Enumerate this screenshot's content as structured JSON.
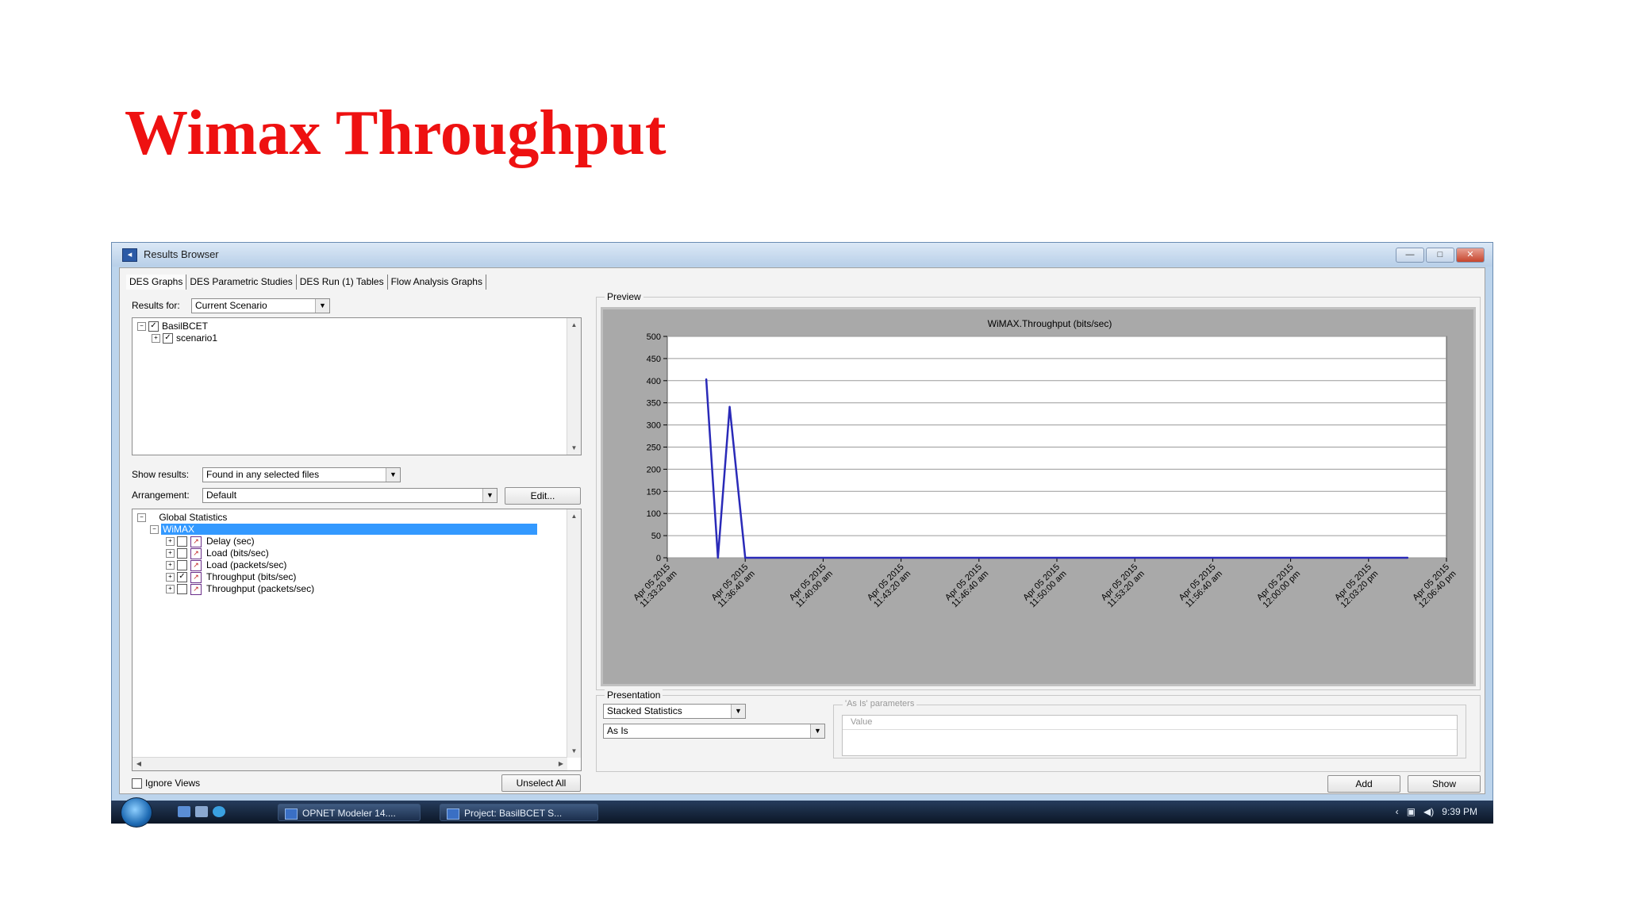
{
  "slide": {
    "title": "Wimax Throughput"
  },
  "window": {
    "title": "Results Browser",
    "controls": {
      "minimize": "—",
      "maximize": "□",
      "close": "✕"
    }
  },
  "tabs": [
    "DES Graphs",
    "DES Parametric Studies",
    "DES Run (1) Tables",
    "Flow Analysis Graphs"
  ],
  "results_for": {
    "label": "Results for:",
    "value": "Current Scenario"
  },
  "project_tree": {
    "root": "BasilBCET",
    "child": "scenario1"
  },
  "show_results": {
    "label": "Show results:",
    "value": "Found in any selected files"
  },
  "arrangement": {
    "label": "Arrangement:",
    "value": "Default",
    "edit_label": "Edit..."
  },
  "stats_tree": {
    "root": "Global Statistics",
    "selected_group": "WiMAX",
    "items": [
      {
        "label": "Delay (sec)",
        "checked": false
      },
      {
        "label": "Load (bits/sec)",
        "checked": false
      },
      {
        "label": "Load (packets/sec)",
        "checked": false
      },
      {
        "label": "Throughput (bits/sec)",
        "checked": true
      },
      {
        "label": "Throughput (packets/sec)",
        "checked": false
      }
    ]
  },
  "ignore_views": {
    "label": "Ignore Views",
    "checked": false
  },
  "unselect_all_label": "Unselect All",
  "preview": {
    "label": "Preview"
  },
  "presentation": {
    "label": "Presentation",
    "mode": "Stacked Statistics",
    "filter": "As Is",
    "params_label": "'As Is' parameters",
    "value_header": "Value"
  },
  "buttons": {
    "add": "Add",
    "show": "Show"
  },
  "taskbar": {
    "items": [
      "OPNET Modeler 14....",
      "Project: BasilBCET S..."
    ],
    "clock": "9:39 PM"
  },
  "colors": {
    "title_red": "#ee1111",
    "series_line": "#2a2ab8",
    "plot_bg": "#ffffff",
    "chart_frame": "#a9a9a9"
  },
  "chart_data": {
    "type": "line",
    "title": "WiMAX.Throughput (bits/sec)",
    "xlabel": "",
    "ylabel": "",
    "ylim": [
      0,
      500
    ],
    "yticks": [
      0,
      50,
      100,
      150,
      200,
      250,
      300,
      350,
      400,
      450,
      500
    ],
    "xtick_labels": [
      [
        "Apr 05 2015",
        "11:33:20 am"
      ],
      [
        "Apr 05 2015",
        "11:36:40 am"
      ],
      [
        "Apr 05 2015",
        "11:40:00 am"
      ],
      [
        "Apr 05 2015",
        "11:43:20 am"
      ],
      [
        "Apr 05 2015",
        "11:46:40 am"
      ],
      [
        "Apr 05 2015",
        "11:50:00 am"
      ],
      [
        "Apr 05 2015",
        "11:53:20 am"
      ],
      [
        "Apr 05 2015",
        "11:56:40 am"
      ],
      [
        "Apr 05 2015",
        "12:00:00 pm"
      ],
      [
        "Apr 05 2015",
        "12:03:20 pm"
      ],
      [
        "Apr 05 2015",
        "12:06:40 pm"
      ]
    ],
    "grid": true,
    "legend": "none",
    "series": [
      {
        "x": [
          "11:35:00",
          "11:35:30",
          "11:36:00",
          "11:36:40",
          "12:05:00"
        ],
        "y": [
          403,
          0,
          341,
          0,
          0
        ]
      }
    ]
  }
}
